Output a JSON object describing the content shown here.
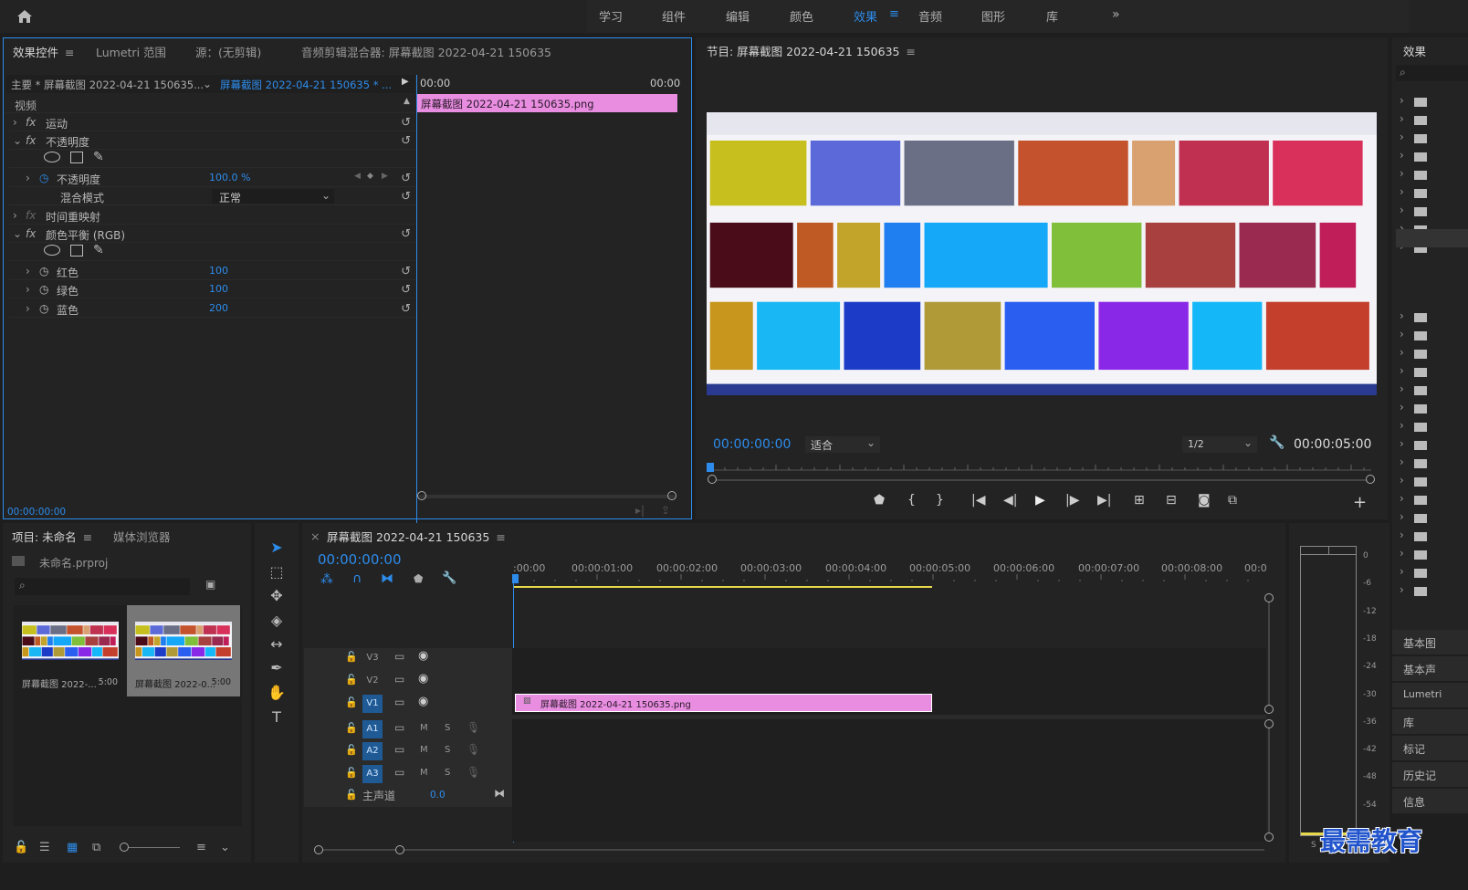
{
  "topbar": {
    "workspaces": [
      "学习",
      "组件",
      "编辑",
      "颜色",
      "效果",
      "音频",
      "图形",
      "库"
    ],
    "active_index": 4,
    "more": "»"
  },
  "effect_controls": {
    "tabs": [
      "效果控件",
      "Lumetri 范围",
      "源：(无剪辑)",
      "音频剪辑混合器: 屏幕截图 2022-04-21 150635"
    ],
    "master": "主要 * 屏幕截图 2022-04-21 150635...",
    "clip": "屏幕截图 2022-04-21 150635 * ...",
    "time_start": "00:00",
    "time_end": "00:00",
    "clip_bar": "屏幕截图 2022-04-21  150635.png",
    "section": "视频",
    "rows": {
      "motion": "运动",
      "opacity_group": "不透明度",
      "opacity": "不透明度",
      "opacity_value": "100.0 %",
      "blend": "混合模式",
      "blend_value": "正常",
      "time_remap": "时间重映射",
      "color_balance": "颜色平衡 (RGB)",
      "red": "红色",
      "red_value": "100",
      "green": "绿色",
      "green_value": "100",
      "blue": "蓝色",
      "blue_value": "200"
    },
    "fx": "fx",
    "timecode": "00:00:00:00"
  },
  "program": {
    "title": "节目: 屏幕截图 2022-04-21 150635",
    "timecode": "00:00:00:00",
    "fit": "适合",
    "resolution": "1/2",
    "duration": "00:00:05:00"
  },
  "effects_panel": {
    "title": "效果",
    "buttons": [
      "基本图",
      "基本声",
      "Lumetri",
      "库",
      "标记",
      "历史记",
      "信息"
    ]
  },
  "project": {
    "tabs": [
      "项目: 未命名",
      "媒体浏览器"
    ],
    "file": "未命名.prproj",
    "items": [
      {
        "name": "屏幕截图 2022-...",
        "duration": "5:00"
      },
      {
        "name": "屏幕截图 2022-0...",
        "duration": "5:00"
      }
    ]
  },
  "timeline": {
    "title": "屏幕截图 2022-04-21 150635",
    "timecode": "00:00:00:00",
    "ruler": [
      ":00:00",
      "00:00:01:00",
      "00:00:02:00",
      "00:00:03:00",
      "00:00:04:00",
      "00:00:05:00",
      "00:00:06:00",
      "00:00:07:00",
      "00:00:08:00",
      "00:0"
    ],
    "tracks_video": [
      "V3",
      "V2",
      "V1"
    ],
    "tracks_audio": [
      "A1",
      "A2",
      "A3"
    ],
    "mix_label": "主声道",
    "mix_value": "0.0",
    "clip": "屏幕截图 2022-04-21  150635.png",
    "m": "M",
    "s": "S"
  },
  "meter": {
    "labels": [
      "0",
      "-6",
      "-12",
      "-18",
      "-24",
      "-30",
      "-36",
      "-42",
      "-48",
      "-54"
    ],
    "s": "S"
  },
  "watermark": "最需教育"
}
